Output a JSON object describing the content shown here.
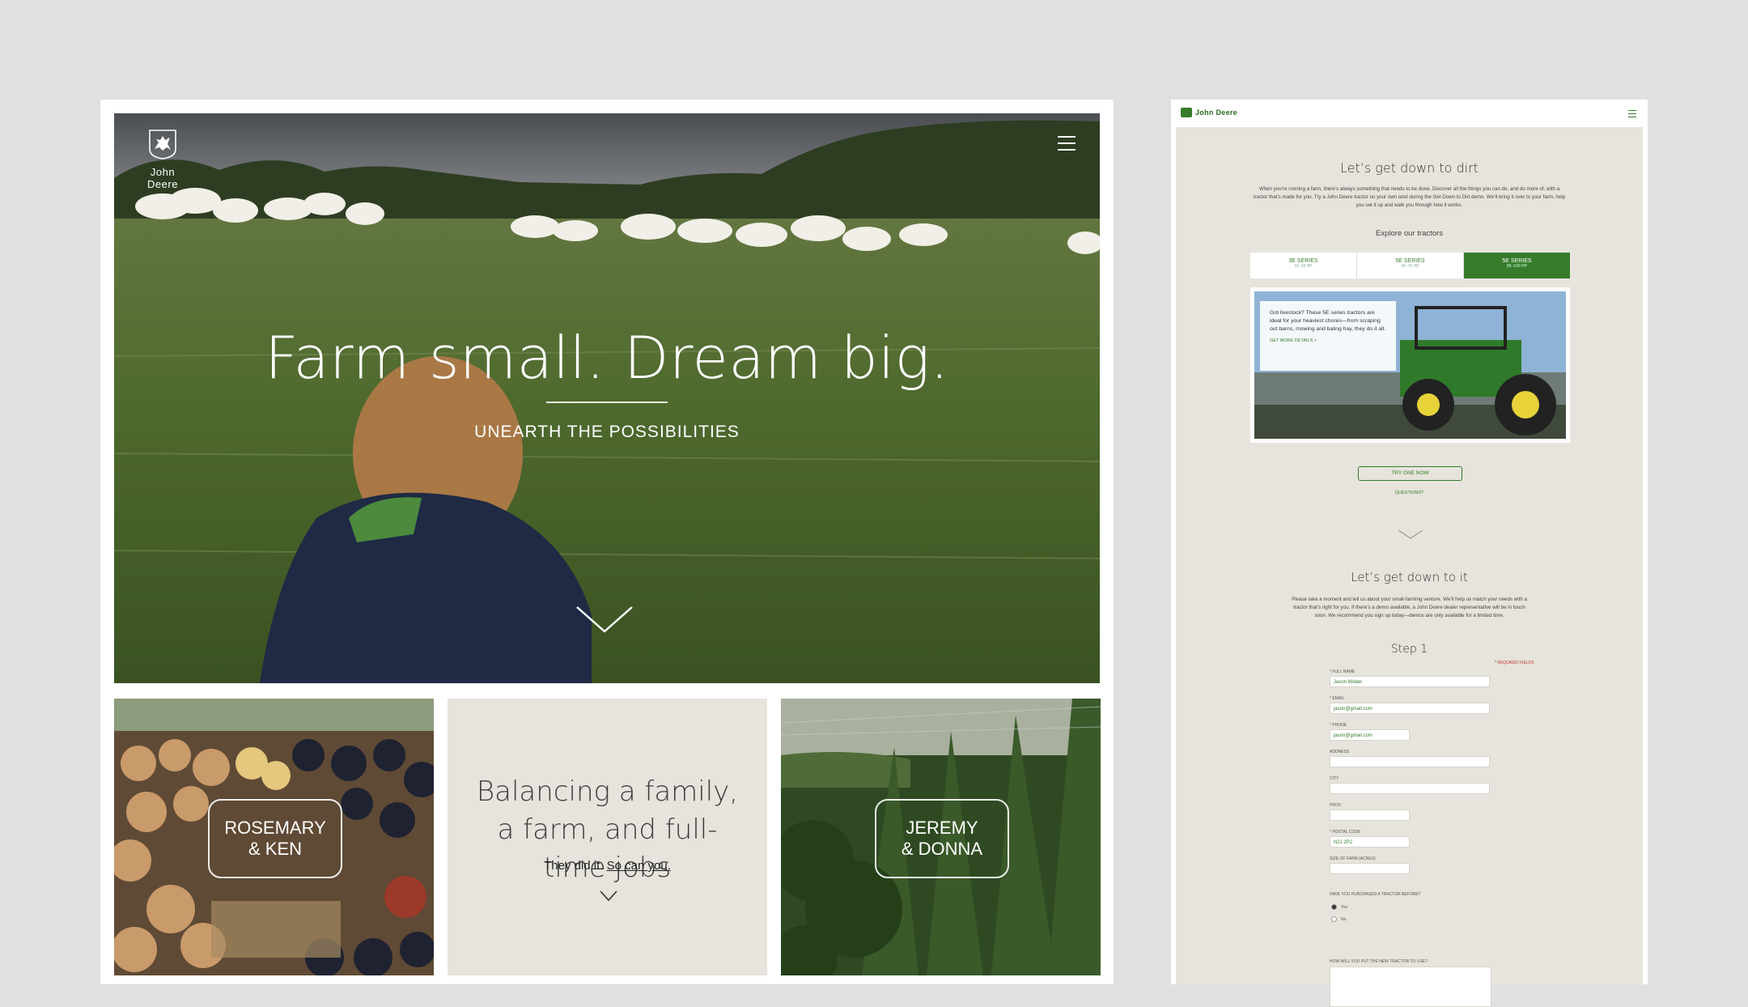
{
  "desktop": {
    "logo_text": "John Deere",
    "headline": "Farm small. Dream big.",
    "subheadline": "UNEARTH THE POSSIBILITIES",
    "tile_left_label_1": "ROSEMARY",
    "tile_left_label_2": "& KEN",
    "tile_center_quote": "Balancing a family, a farm, and full-time jobs",
    "tile_center_sub_prefix": "They did it.",
    "tile_center_sub_link": "So can you.",
    "tile_right_label_1": "JEREMY",
    "tile_right_label_2": "& DONNA"
  },
  "mobile": {
    "logo_text": "John Deere",
    "heading1": "Let’s get down to dirt",
    "intro": "When you’re running a farm, there’s always something that needs to be done. Discover all the things you can do, and do more of, with a tractor that’s made for you. Try a John Deere tractor on your own land during the Get Down to Dirt demo. We’ll bring it over to your farm, help you set it up and walk you through how it works.",
    "explore": "Explore our tractors",
    "tabs": [
      {
        "label": "3E SERIES",
        "sub": "32–38 HP"
      },
      {
        "label": "5E SERIES",
        "sub": "45–75 HP"
      },
      {
        "label": "5E SERIES",
        "sub": "85–100 HP"
      }
    ],
    "promo_text": "Got livestock? These 5E series tractors are ideal for your heaviest chores—from scraping out barns, mowing and baling hay, they do it all.",
    "promo_link": "GET MORE DETAILS >",
    "try_button": "TRY ONE NOW",
    "questions_link": "QUESTIONS?",
    "heading2": "Let’s get down to it",
    "form_intro": "Please take a moment and tell us about your small-farming venture. We’ll help us match your needs with a tractor that’s right for you. If there’s a demo available, a John Deere dealer representative will be in touch soon. We recommend you sign up today—demos are only available for a limited time.",
    "step_label": "Step 1",
    "required_note": "* REQUIRED FIELDS",
    "fields": [
      {
        "label": "* FULL NAME",
        "value": "Jason Weber"
      },
      {
        "label": "* EMAIL",
        "value": "jason@gmail.com"
      },
      {
        "label": "* PHONE",
        "value": "jason@gmail.com"
      },
      {
        "label": "ADDRESS",
        "value": ""
      },
      {
        "label": "CITY",
        "value": ""
      },
      {
        "label": "PROV",
        "value": ""
      },
      {
        "label": "* POSTAL CODE",
        "value": "N2J 2P2"
      },
      {
        "label": "SIZE OF FARM (ACRES)",
        "value": ""
      }
    ],
    "question_purchased": "HAVE YOU PURCHASED A TRACTOR BEFORE?",
    "radio_yes": "Yes",
    "radio_no": "No",
    "question_use": "HOW WILL YOU PUT THE NEW TRACTOR TO USE?"
  },
  "colors": {
    "brand_green": "#367c2b",
    "page_bg": "#e0e0e0",
    "beige": "#e6e4dc"
  },
  "icons": [
    "deer-logo-icon",
    "hamburger-menu-icon",
    "chevron-down-icon"
  ]
}
